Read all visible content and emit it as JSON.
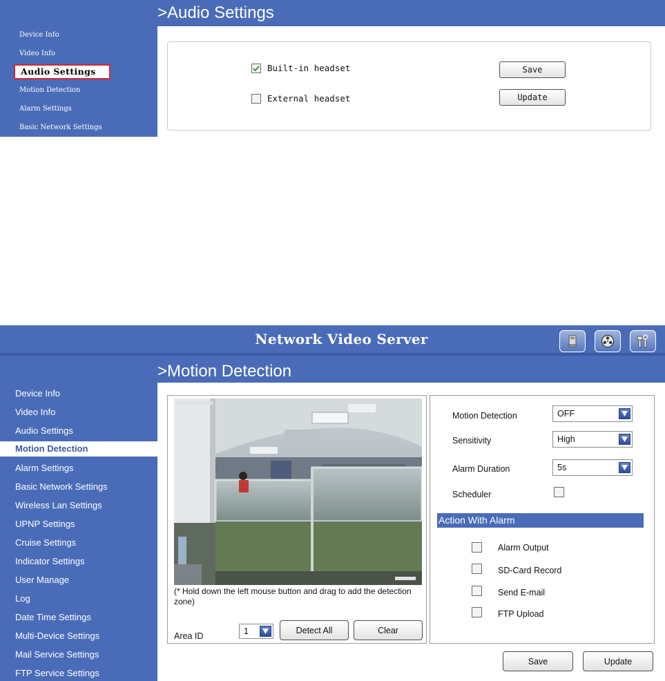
{
  "audio_panel": {
    "title": ">Audio Settings",
    "sidebar_items": [
      "Device Info",
      "Video Info",
      "Audio Settings",
      "Motion Detection",
      "Alarm Settings",
      "Basic Network Settings"
    ],
    "active_item": "Audio Settings",
    "options": [
      {
        "label": "Built-in headset",
        "checked": true
      },
      {
        "label": "External headset",
        "checked": false
      }
    ],
    "save_label": "Save",
    "update_label": "Update"
  },
  "motion_panel": {
    "app_title": "Network Video Server",
    "header_icons": [
      "monitor-icon",
      "film-reel-icon",
      "tools-icon"
    ],
    "title": ">Motion Detection",
    "sidebar_items": [
      "Device Info",
      "Video Info",
      "Audio Settings",
      "Motion Detection",
      "Alarm Settings",
      "Basic Network Settings",
      "Wireless Lan Settings",
      "UPNP Settings",
      "Cruise Settings",
      "Indicator Settings",
      "User Manage",
      "Log",
      "Date Time Settings",
      "Multi-Device Settings",
      "Mail Service Settings",
      "FTP Service Settings"
    ],
    "active_item": "Motion Detection",
    "video_hint": "(* Hold down the left mouse button and drag to add the detection zone)",
    "area_id_label": "Area ID",
    "area_id_value": "1",
    "detect_all_label": "Detect All",
    "clear_label": "Clear",
    "settings": {
      "motion_detection_label": "Motion Detection",
      "motion_detection_value": "OFF",
      "sensitivity_label": "Sensitivity",
      "sensitivity_value": "High",
      "alarm_duration_label": "Alarm Duration",
      "alarm_duration_value": "5s",
      "scheduler_label": "Scheduler",
      "scheduler_checked": false
    },
    "action_header": "Action With Alarm",
    "actions": [
      "Alarm Output",
      "SD-Card Record",
      "Send E-mail",
      "FTP Upload"
    ],
    "save_label": "Save",
    "update_label": "Update"
  },
  "colors": {
    "brand_blue": "#4a6cb8",
    "active_outline": "#d8262e",
    "check_green": "#2e8b2e"
  }
}
